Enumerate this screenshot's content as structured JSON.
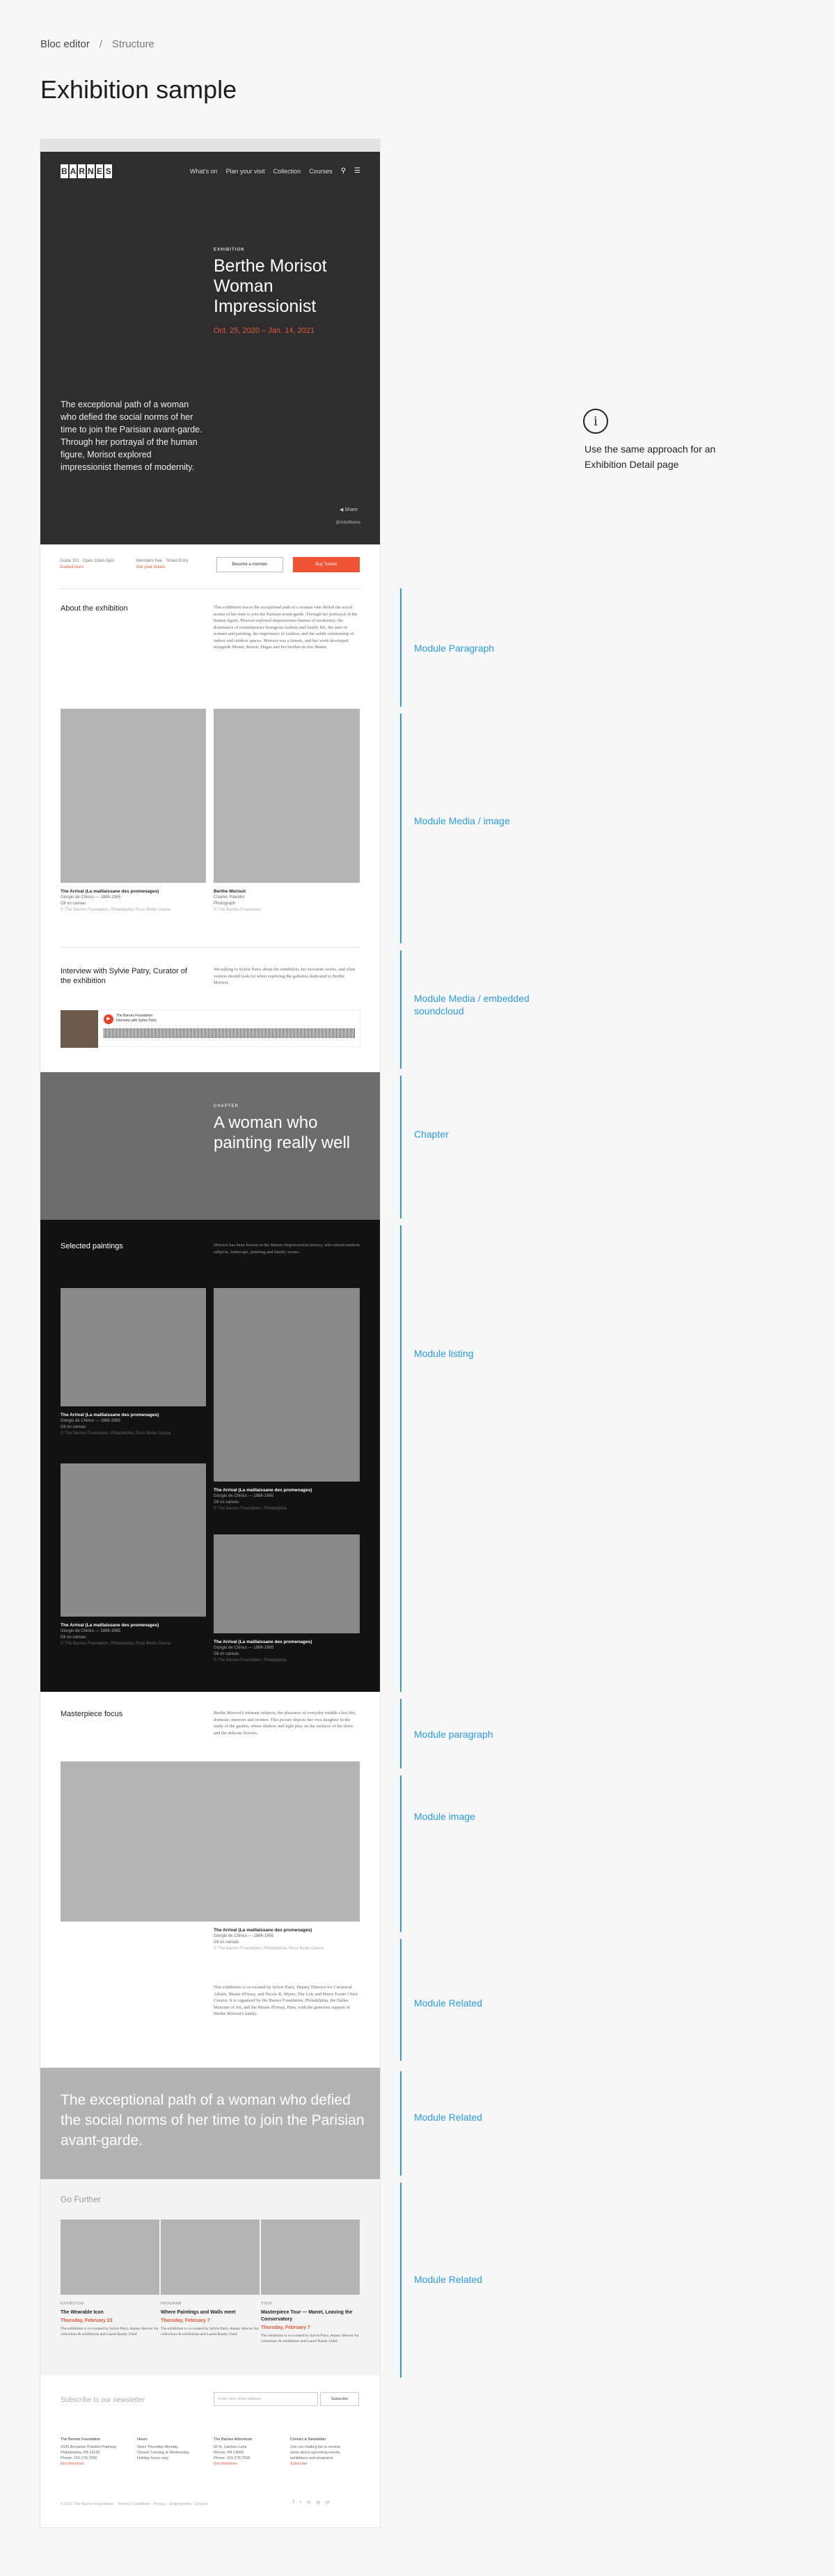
{
  "breadcrumb": {
    "root": "Bloc editor",
    "separator": "/",
    "current": "Structure"
  },
  "page_title": "Exhibition sample",
  "hero": {
    "logo_letters": [
      "B",
      "A",
      "R",
      "N",
      "E",
      "S"
    ],
    "nav": [
      "What's on",
      "Plan your visit",
      "Collection",
      "Courses"
    ],
    "eyebrow": "EXHIBITION",
    "title": "Berthe Morisot Woman Impressionist",
    "date": "Oct. 25, 2020 – Jan. 14, 2021",
    "lede": "The exceptional path of a woman who defied the social norms of her time to join the Parisian avant-garde. Through her portrayal of the human figure, Morisot explored impressionist themes of modernity.",
    "share": "Share",
    "credit": "@ArtistName"
  },
  "infobar": {
    "hours": "Guide 101 · Open 10am-5pm",
    "hours_link": "Guided tours",
    "member_line": "Members free · Timed Entry",
    "member_link": "Get your tickets",
    "member_button": "Become a member",
    "tickets_button": "Buy Tickets"
  },
  "about": {
    "heading": "About the exhibition",
    "text": "This exhibition traces the exceptional path of a woman who defied the social norms of her time to join the Parisian avant-garde. Through her portrayal of the human figure, Morisot explored impressionist themes of modernity; the dominance of contemporary bourgeois fashion and family life, the auto of women and painting, the importance of fashion, and the subtle relationship of indoor and outdoor spaces. Morisot was a female, and her work developed alongside Monet, Renoir, Degas and her brother-in-law Manet.",
    "images": [
      {
        "title": "The Arrival (La maillaissane des promenages)",
        "line1": "Giorgio de Chirico — 1888-1965",
        "line2": "Oil on canvas",
        "credit": "© The Barnes Foundation, Philadelphia, Ross Bedio Garcia"
      },
      {
        "title": "Berthe Morisot",
        "line1": "Charles Pilandre",
        "line2": "Photograph",
        "credit": "© The Barnes Foundation"
      }
    ]
  },
  "interview": {
    "heading": "Interview with Sylvie Patry, Curator of the exhibition",
    "text": "We talking to Sylvie Patry about the exhibition, her favourite works, and what visitors should look for when exploring the galleries dedicated to Berthe Morisot.",
    "sound_line1": "The Barnes Foundation",
    "sound_line2": "Interview with Sylvie Patry"
  },
  "chapter": {
    "eyebrow": "CHAPTER",
    "title": "A woman who painting really well"
  },
  "listing": {
    "heading": "Selected paintings",
    "text": "Morisot has been known in the Barnes Impressionist history, who mixed modern subjects, landscape, painting and family scenes.",
    "items": [
      {
        "title": "The Arrival (La maillaissane des promenages)",
        "line1": "Giorgio de Chirico — 1888-1965",
        "line2": "Oil on canvas",
        "credit": "© The Barnes Foundation, Philadelphia, Ross Bedio Garcia"
      },
      {
        "title": "The Arrival (La maillaissane des promenages)",
        "line1": "Giorgio de Chirico — 1888-1965",
        "line2": "Oil on canvas",
        "credit": "© The Barnes Foundation, Philadelphia"
      },
      {
        "title": "The Arrival (La maillaissane des promenages)",
        "line1": "Giorgio de Chirico — 1888-1965",
        "line2": "Oil on canvas",
        "credit": "© The Barnes Foundation, Philadelphia, Ross Bedio Garcia"
      },
      {
        "title": "The Arrival (La maillaissane des promenages)",
        "line1": "Giorgio de Chirico — 1888-1965",
        "line2": "Oil on canvas",
        "credit": "© The Barnes Foundation, Philadelphia"
      }
    ]
  },
  "masterpiece": {
    "heading": "Masterpiece focus",
    "text": "Berthe Morisot's intimate subjects, the pleasures of everyday middle-class life, domestic interiors and women. This picture depicts her own daughter in the study of the garden, where shadow and light play on the surfaces of her dress and the delicate flowers.",
    "caption": {
      "title": "The Arrival (La maillaissane des promenages)",
      "line1": "Giorgio de Chirico — 1888-1965",
      "line2": "Oil on canvas",
      "credit": "© The Barnes Foundation, Philadelphia, Ross Bedio Garcia"
    },
    "related_text": "This exhibition is co-curated by Sylvie Patry, Deputy Director for Curatorial Affairs, Musée d'Orsay, and Nicole R. Myers, The Lois and Henry Foster Chief Curator. It is organized by the Barnes Foundation, Philadelphia, the Dallas Museum of Art, and the Musée d'Orsay, Paris, with the generous support of Berthe Morisot's family."
  },
  "quote": "The exceptional path of a woman who defied the social norms of her time to join the Parisian avant-garde.",
  "gofurther": {
    "heading": "Go Further",
    "cards": [
      {
        "eyebrow": "EXHIBITION",
        "title": "The Wearable Icon",
        "date": "Thursday, February 23",
        "text": "The exhibition is co-curated by Sylvie Patry, deputy director for collections & exhibitions and Laurel Randy Chief."
      },
      {
        "eyebrow": "PROGRAM",
        "title": "Where Paintings and Walls meet",
        "date": "Thursday, February 7",
        "text": "The exhibition is co-curated by Sylvie Patry, deputy director for collections & exhibitions and Laurel Randy Chief."
      },
      {
        "eyebrow": "TOUR",
        "title": "Masterpiece Tour — Manet, Leaving the Conservatory",
        "date": "Thursday, February 7",
        "text": "The exhibition is co-curated by Sylvie Patry, deputy director for collections & exhibitions and Laurel Randy Chief."
      }
    ]
  },
  "footer": {
    "newsletter_label": "Subscribe to our newsletter",
    "newsletter_placeholder": "Enter your email address",
    "subscribe": "Subscribe",
    "cols": [
      {
        "title": "The Barnes Foundation",
        "lines": [
          "2025 Benjamin Franklin Parkway",
          "Philadelphia, PA 19130",
          "Phone: 215.278.7000"
        ],
        "link": "Get directions"
      },
      {
        "title": "Hours",
        "lines": [
          "Open Thursday-Monday",
          "Closed Tuesday & Wednesday",
          "Holiday hours vary"
        ],
        "link": ""
      },
      {
        "title": "The Barnes Arboretum",
        "lines": [
          "50 N. Latches Lane",
          "Merion, PA 19066",
          "Phone: 215.278.7000"
        ],
        "link": "Get directions"
      },
      {
        "title": "Contact & Newsletter",
        "lines": [
          "Join our mailing list to receive",
          "news about upcoming events,",
          "exhibitions and programs"
        ],
        "link": "Subscribe"
      }
    ],
    "copyright": "© 2021 The Barnes Foundation",
    "links": "Terms & Conditions · Privacy · Employment · Contact",
    "social": [
      "f",
      "t",
      "in",
      "ig",
      "yt"
    ]
  },
  "annotations": {
    "note": "Use the same approach for an Exhibition Detail page",
    "labels": [
      "Module Paragraph",
      "Module Media / image",
      "Module Media / embedded soundcloud",
      "Chapter",
      "Module listing",
      "Module paragraph",
      "Module image",
      "Module Related",
      "Module Related",
      "Module Related"
    ]
  },
  "colors": {
    "accent": "#2b9be6",
    "brand_red": "#e8563a",
    "dark": "#2e2e2e",
    "listing_bg": "#121212"
  },
  "icons": [
    "search-icon",
    "menu-icon",
    "share-icon",
    "play-icon",
    "info-icon"
  ]
}
